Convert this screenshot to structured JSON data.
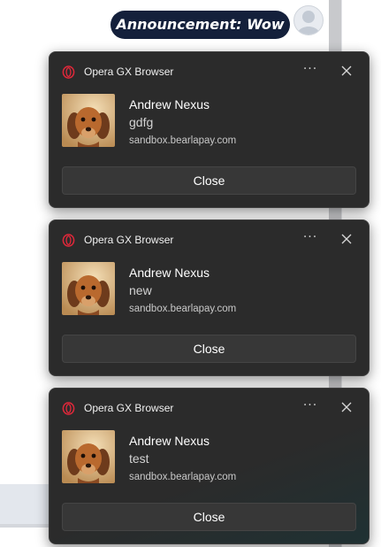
{
  "chat": {
    "announcement": "Announcement: Wow"
  },
  "notifications": [
    {
      "app_name": "Opera GX Browser",
      "more_label": "···",
      "title": "Andrew Nexus",
      "body": "gdfg",
      "source": "sandbox.bearlapay.com",
      "close_label": "Close"
    },
    {
      "app_name": "Opera GX Browser",
      "more_label": "···",
      "title": "Andrew Nexus",
      "body": "new",
      "source": "sandbox.bearlapay.com",
      "close_label": "Close"
    },
    {
      "app_name": "Opera GX Browser",
      "more_label": "···",
      "title": "Andrew Nexus",
      "body": "test",
      "source": "sandbox.bearlapay.com",
      "close_label": "Close"
    }
  ],
  "icons": {
    "app": "opera-gx-icon",
    "more": "more-horizontal-icon",
    "dismiss": "close-icon",
    "avatar": "user-avatar-icon",
    "thumbnail": "puppy-avatar"
  },
  "colors": {
    "announcement_bg": "#14203b",
    "toast_bg": "#2b2b2b",
    "opera_red": "#e0283a"
  }
}
